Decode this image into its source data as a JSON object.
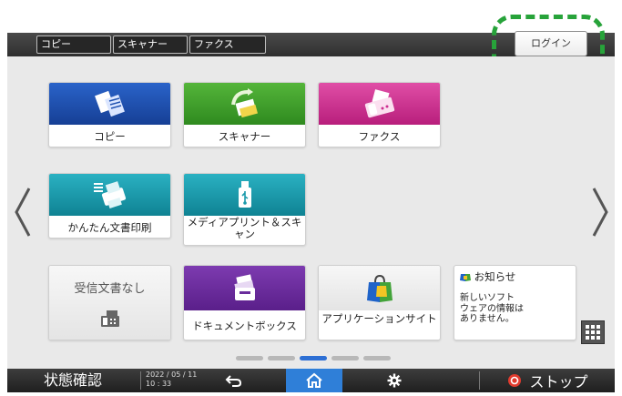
{
  "top_tabs": [
    {
      "label": "コピー"
    },
    {
      "label": "スキャナー"
    },
    {
      "label": "ファクス"
    }
  ],
  "login": {
    "label": "ログイン"
  },
  "tiles": {
    "copy": {
      "label": "コピー"
    },
    "scanner": {
      "label": "スキャナー"
    },
    "fax": {
      "label": "ファクス"
    },
    "easy_print": {
      "label": "かんたん文書印刷"
    },
    "media_print": {
      "label": "メディアプリント＆スキャン"
    },
    "received_docs": {
      "label": "受信文書なし"
    },
    "document_box": {
      "label": "ドキュメントボックス"
    },
    "app_site": {
      "label": "アプリケーションサイト"
    }
  },
  "notice": {
    "title": "お知らせ",
    "text": "新しいソフト\nウェアの情報は\nありません。"
  },
  "pagination": {
    "total": 5,
    "active_index": 2
  },
  "bottom": {
    "status_label": "状態確認",
    "date": "2022 / 05 / 11",
    "time": "10 : 33",
    "stop_label": "ストップ"
  },
  "colors": {
    "highlight": "#27a33a",
    "home_active": "#2f7fd8",
    "copy_band": "#1f51b0",
    "scanner_band": "#3f9f2b",
    "fax_band": "#cc2f90",
    "teal_band": "#1a9aab",
    "purple_band": "#6a2c9c"
  },
  "icons": {
    "back": "back-arrow-icon",
    "home": "home-icon",
    "settings": "gear-icon",
    "stop": "stop-icon"
  }
}
